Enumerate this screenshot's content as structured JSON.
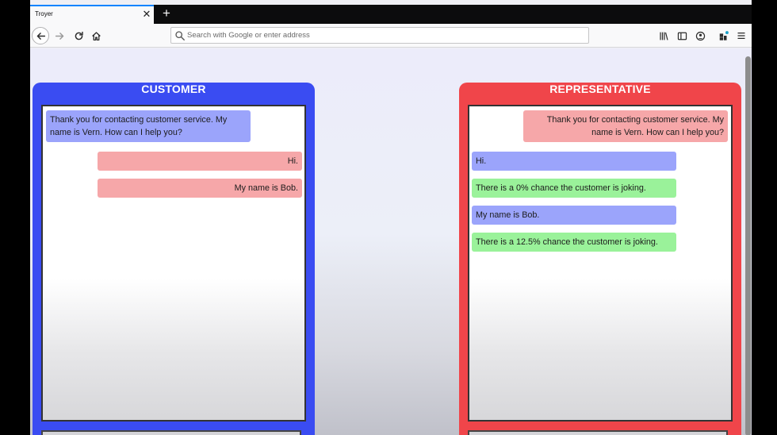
{
  "browser": {
    "tab_title": "Troyer",
    "tab_close": "✕",
    "new_tab": "+",
    "url_placeholder": "Search with Google or enter address",
    "url_value": ""
  },
  "customer": {
    "title": "CUSTOMER",
    "messages": [
      {
        "text": "Thank you for contacting customer service. My name is Vern. How can I help you?",
        "color": "blue"
      },
      {
        "text": "Hi.",
        "color": "pink"
      },
      {
        "text": "My name is Bob.",
        "color": "pink"
      }
    ]
  },
  "representative": {
    "title": "REPRESENTATIVE",
    "messages": [
      {
        "text": "Thank you for contacting customer service. My name is Vern. How can I help you?",
        "color": "pink"
      },
      {
        "text": "Hi.",
        "color": "blue"
      },
      {
        "text": "There is a 0% chance the customer is joking.",
        "color": "green"
      },
      {
        "text": "My name is Bob.",
        "color": "blue"
      },
      {
        "text": "There is a 12.5% chance the customer is joking.",
        "color": "green"
      }
    ]
  },
  "colors": {
    "customer_panel": "#3a4cf2",
    "representative_panel": "#f0454a",
    "bubble_blue": "#9ba4fb",
    "bubble_pink": "#f6a7a9",
    "bubble_green": "#9af29a"
  },
  "icons": [
    "close-icon",
    "plus-icon",
    "back-arrow-icon",
    "forward-arrow-icon",
    "reload-icon",
    "home-icon",
    "search-icon",
    "library-icon",
    "sidebar-icon",
    "account-icon",
    "extension-icon",
    "hamburger-menu-icon"
  ]
}
